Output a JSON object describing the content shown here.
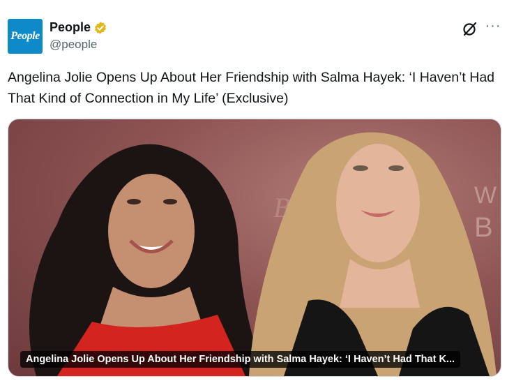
{
  "author": {
    "avatar_text": "People",
    "display_name": "People",
    "handle": "@people",
    "verified_color": "#E2B719"
  },
  "icons": {
    "grok": "grok-icon",
    "more": "more-icon",
    "verified": "verified-badge-icon"
  },
  "tweet": {
    "text": "Angelina Jolie Opens Up About Her Friendship with Salma Hayek: ‘I Haven’t Had That Kind of Connection in My Life’ (Exclusive)"
  },
  "card": {
    "title": "Angelina Jolie Opens Up About Her Friendship with Salma Hayek: ‘I Haven’t Had That K..."
  },
  "colors": {
    "avatar_bg": "#0D8AC7",
    "text": "#0F1419",
    "secondary_text": "#536471"
  }
}
